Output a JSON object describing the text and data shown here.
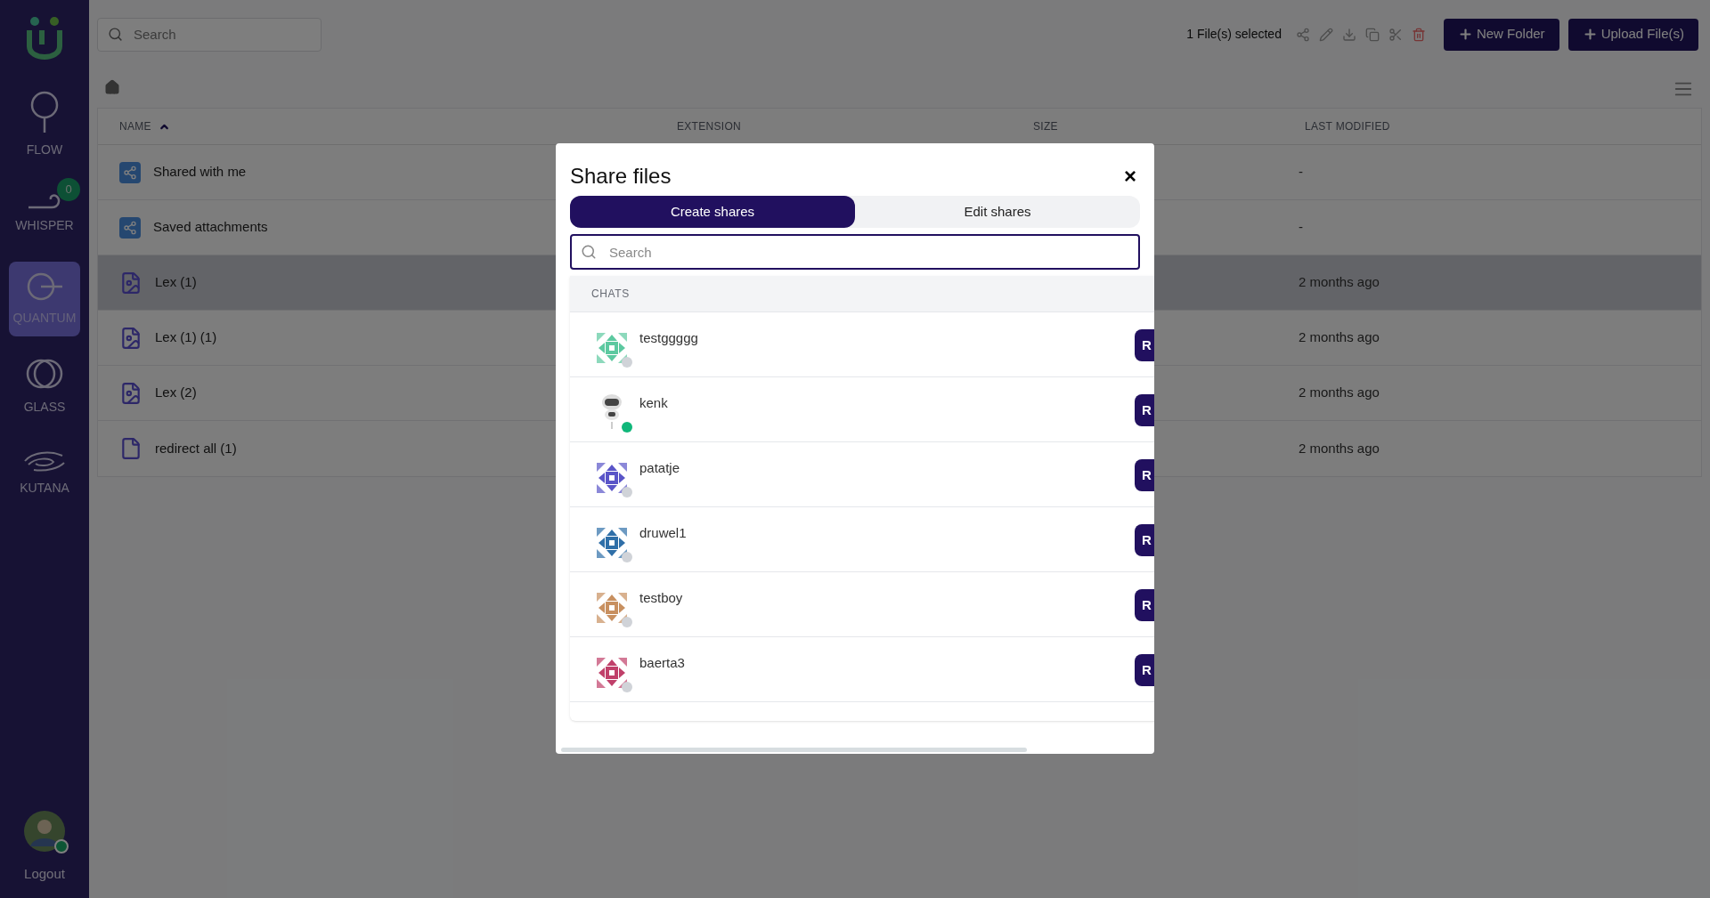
{
  "sidebar": {
    "items": [
      {
        "label": "FLOW",
        "kind": "flow",
        "selected": false
      },
      {
        "label": "WHISPER",
        "kind": "whisper",
        "selected": false,
        "badge": "0"
      },
      {
        "label": "QUANTUM",
        "kind": "quantum",
        "selected": true
      },
      {
        "label": "GLASS",
        "kind": "glass",
        "selected": false
      },
      {
        "label": "KUTANA",
        "kind": "kutana",
        "selected": false
      }
    ],
    "user": {
      "online": true,
      "logout": "Logout"
    }
  },
  "search": {
    "placeholder": "Search"
  },
  "toolbar": {
    "selection": "1 File(s) selected",
    "new_folder": "New Folder",
    "upload": "Upload File(s)"
  },
  "table": {
    "columns": [
      {
        "label": "NAME",
        "sorted": true
      },
      {
        "label": "EXTENSION",
        "sorted": false
      },
      {
        "label": "SIZE",
        "sorted": false
      },
      {
        "label": "LAST MODIFIED",
        "sorted": false
      }
    ],
    "rows": [
      {
        "name": "Shared with me",
        "kind": "share",
        "last_modified": "-",
        "selected": false
      },
      {
        "name": "Saved attachments",
        "kind": "share",
        "last_modified": "-",
        "selected": false
      },
      {
        "name": "Lex (1)",
        "kind": "image",
        "last_modified": "2 months ago",
        "selected": true
      },
      {
        "name": "Lex (1) (1)",
        "kind": "image",
        "last_modified": "2 months ago",
        "selected": false
      },
      {
        "name": "Lex (2)",
        "kind": "image",
        "last_modified": "2 months ago",
        "selected": false
      },
      {
        "name": "redirect all (1)",
        "kind": "file",
        "last_modified": "2 months ago",
        "selected": false
      }
    ]
  },
  "dialog": {
    "title": "Share files",
    "close": "×",
    "tabs": [
      {
        "label": "Create shares",
        "selected": true
      },
      {
        "label": "Edit shares",
        "selected": false
      }
    ],
    "search": {
      "placeholder": "Search"
    },
    "section": "CHATS",
    "chats": [
      {
        "name": "testggggg",
        "kind": "pattern",
        "color": "#5cc9a0",
        "online": false,
        "action": "R"
      },
      {
        "name": "kenk",
        "kind": "robot",
        "color": "#444444",
        "online": true,
        "action": "R"
      },
      {
        "name": "patatje",
        "kind": "pattern",
        "color": "#5a55c8",
        "online": false,
        "action": "R"
      },
      {
        "name": "druwel1",
        "kind": "pattern",
        "color": "#2f6fa8",
        "online": false,
        "action": "R"
      },
      {
        "name": "testboy",
        "kind": "pattern",
        "color": "#c89060",
        "online": false,
        "action": "R"
      },
      {
        "name": "baerta3",
        "kind": "pattern",
        "color": "#c0406a",
        "online": false,
        "action": "R"
      }
    ]
  }
}
